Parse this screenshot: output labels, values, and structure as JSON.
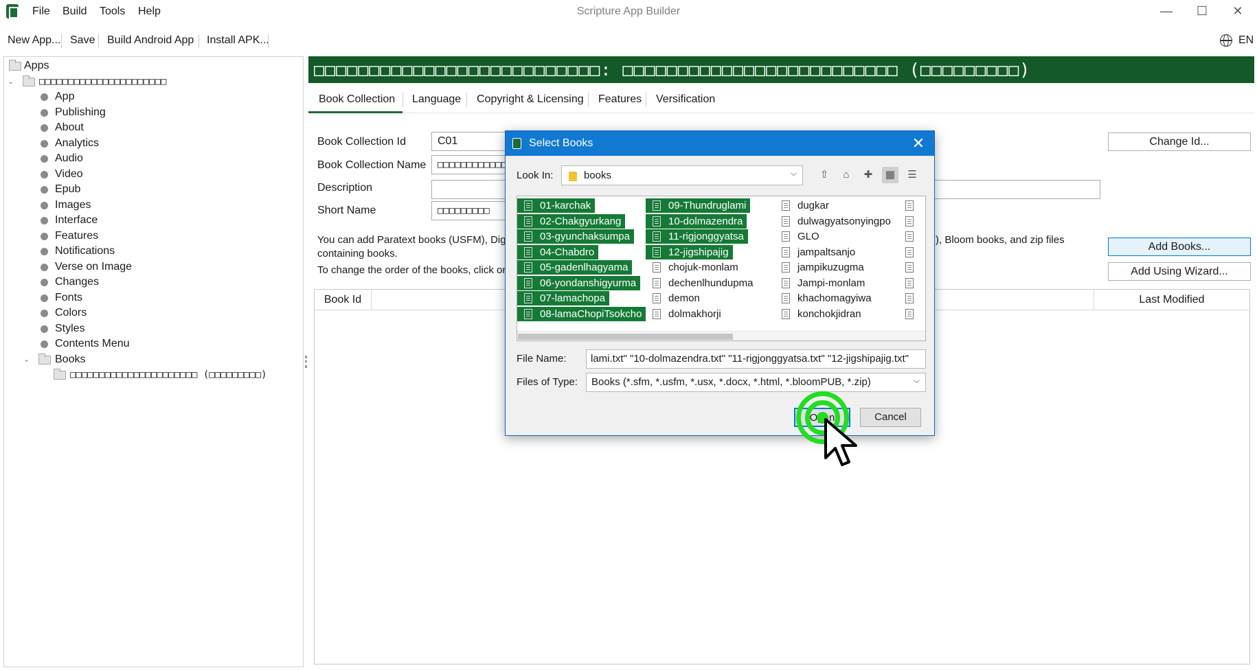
{
  "window": {
    "title": "Scripture App Builder",
    "menus": [
      "File",
      "Build",
      "Tools",
      "Help"
    ],
    "controls": {
      "minimize": "—",
      "maximize": "☐",
      "close": "✕"
    }
  },
  "toolbar": {
    "new_app": "New App...",
    "save": "Save",
    "build_android": "Build Android App",
    "install_apk": "Install APK...",
    "language": "EN"
  },
  "tree": {
    "root": "Apps",
    "app_name": "□□□□□□□□□□□□□□□□□□□□□□",
    "items": [
      "App",
      "Publishing",
      "About",
      "Analytics",
      "Audio",
      "Video",
      "Epub",
      "Images",
      "Interface",
      "Features",
      "Notifications",
      "Verse on Image",
      "Changes",
      "Fonts",
      "Colors",
      "Styles",
      "Contents Menu"
    ],
    "books_folder": "Books",
    "collection": "□□□□□□□□□□□□□□□□□□□□□□ (□□□□□□□□□)"
  },
  "header": {
    "title": "□□□□□□□□□□□□□□□□□□□□□□□□□□: □□□□□□□□□□□□□□□□□□□□□□□□□ (□□□□□□□□□)"
  },
  "tabs": [
    "Book Collection",
    "Language",
    "Copyright & Licensing",
    "Features",
    "Versification"
  ],
  "form": {
    "id_label": "Book Collection Id",
    "id_value": "C01",
    "name_label": "Book Collection Name",
    "name_value": "□□□□□□□□□□□□",
    "description_label": "Description",
    "description_value": "",
    "short_name_label": "Short Name",
    "short_name_value": "□□□□□□□□□",
    "info_line1_left": "You can add Paratext books (USFM), Digi",
    "info_line1_right": "), Bloom books, and zip files",
    "info_line2": "containing books.",
    "info_line3": "To change the order of the books, click on"
  },
  "buttons": {
    "change_id": "Change Id...",
    "add_books": "Add Books...",
    "add_wizard": "Add Using Wizard..."
  },
  "table": {
    "col_book_id": "Book Id",
    "col_last_modified": "Last Modified"
  },
  "dialog": {
    "title": "Select Books",
    "close": "✕",
    "look_in_label": "Look In:",
    "look_in_value": "books",
    "files": [
      {
        "name": "01-karchak",
        "selected": true
      },
      {
        "name": "02-Chakgyurkang",
        "selected": true
      },
      {
        "name": "03-gyunchaksumpa",
        "selected": true
      },
      {
        "name": "04-Chabdro",
        "selected": true
      },
      {
        "name": "05-gadenlhagyama",
        "selected": true
      },
      {
        "name": "06-yondanshigyurma",
        "selected": true
      },
      {
        "name": "07-lamachopa",
        "selected": true
      },
      {
        "name": "08-lamaChopiTsokcho",
        "selected": true
      },
      {
        "name": "09-Thundruglami",
        "selected": true
      },
      {
        "name": "10-dolmazendra",
        "selected": true
      },
      {
        "name": "11-rigjonggyatsa",
        "selected": true
      },
      {
        "name": "12-jigshipajig",
        "selected": true
      },
      {
        "name": "chojuk-monlam",
        "selected": false
      },
      {
        "name": "dechenlhundupma",
        "selected": false
      },
      {
        "name": "demon",
        "selected": false
      },
      {
        "name": "dolmakhorji",
        "selected": false
      },
      {
        "name": "dugkar",
        "selected": false
      },
      {
        "name": "dulwagyatsonyingpo",
        "selected": false
      },
      {
        "name": "GLO",
        "selected": false
      },
      {
        "name": "jampaltsanjo",
        "selected": false
      },
      {
        "name": "jampikuzugma",
        "selected": false
      },
      {
        "name": "Jampi-monlam",
        "selected": false
      },
      {
        "name": "khachomagyiwa",
        "selected": false
      },
      {
        "name": "konchokjidran",
        "selected": false
      },
      {
        "name": "",
        "selected": false
      },
      {
        "name": "",
        "selected": false
      },
      {
        "name": "",
        "selected": false
      },
      {
        "name": "",
        "selected": false
      },
      {
        "name": "",
        "selected": false
      },
      {
        "name": "",
        "selected": false
      },
      {
        "name": "",
        "selected": false
      },
      {
        "name": "",
        "selected": false
      }
    ],
    "file_name_label": "File Name:",
    "file_name_value": "lami.txt\" \"10-dolmazendra.txt\" \"11-rigjonggyatsa.txt\" \"12-jigshipajig.txt\"",
    "files_type_label": "Files of Type:",
    "files_type_value": "Books (*.sfm, *.usfm, *.usx, *.docx, *.html, *.bloomPUB, *.zip)",
    "open": "Open",
    "cancel": "Cancel"
  },
  "colors": {
    "accent_green": "#135a28",
    "selection_green": "#157a36",
    "dialog_title_blue": "#1279d3",
    "click_indicator": "#22dd22"
  }
}
